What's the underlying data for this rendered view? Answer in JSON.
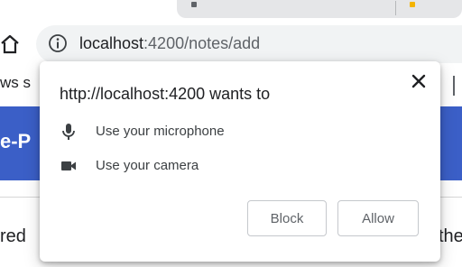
{
  "browser": {
    "url_host": "localhost",
    "url_rest": ":4200/notes/add"
  },
  "page": {
    "nav_fragment": "ws s",
    "band_text": "e-P",
    "left_fragment": "red",
    "right_fragment": "the"
  },
  "dialog": {
    "title": "http://localhost:4200 wants to",
    "permissions": [
      {
        "icon": "microphone-icon",
        "label": "Use your microphone"
      },
      {
        "icon": "camera-icon",
        "label": "Use your camera"
      }
    ],
    "block_label": "Block",
    "allow_label": "Allow"
  },
  "colors": {
    "accent_band": "#3b5fc7",
    "omnibox_bg": "#f1f3f4",
    "tab_bg": "#e5e6e8"
  }
}
